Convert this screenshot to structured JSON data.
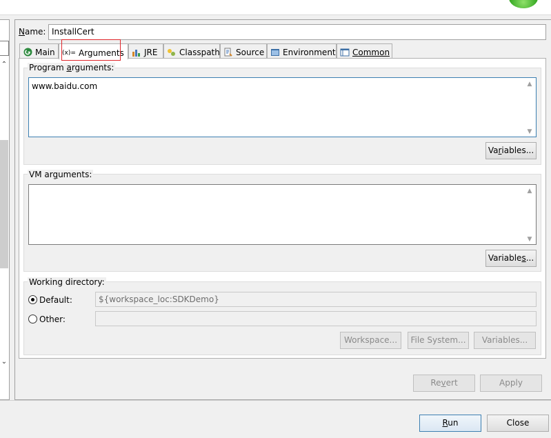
{
  "name": {
    "label_prefix": "N",
    "label_rest": "ame:",
    "value": "InstallCert"
  },
  "tabs": [
    {
      "id": "main",
      "label": "Main",
      "icon": "main-run-icon"
    },
    {
      "id": "arguments",
      "label": "Arguments",
      "icon": "arguments-icon",
      "icon_text": "(x)="
    },
    {
      "id": "jre",
      "label": "JRE",
      "icon": "jre-icon"
    },
    {
      "id": "classpath",
      "label": "Classpath",
      "icon": "classpath-icon"
    },
    {
      "id": "source",
      "label": "Source",
      "icon": "source-icon"
    },
    {
      "id": "environment",
      "label": "Environment",
      "icon": "environment-icon"
    },
    {
      "id": "common",
      "label": "Common",
      "icon": "common-icon"
    }
  ],
  "program_args": {
    "label_a": "Program ",
    "label_b": "a",
    "label_c": "rguments:",
    "value": "www.baidu.com",
    "variables_a": "Va",
    "variables_b": "r",
    "variables_c": "iables..."
  },
  "vm_args": {
    "label_a": "VM ar",
    "label_b": "g",
    "label_c": "uments:",
    "value": "",
    "variables_a": "Variable",
    "variables_b": "s",
    "variables_c": "..."
  },
  "working_dir": {
    "label": "Working directory:",
    "default_label": "Default:",
    "default_value": "${workspace_loc:SDKDemo}",
    "other_label": "Other:",
    "other_value": "",
    "workspace_btn": "Workspace...",
    "filesystem_btn": "File System...",
    "variables_btn": "Variables..."
  },
  "actions": {
    "revert_a": "Re",
    "revert_b": "v",
    "revert_c": "ert",
    "apply": "Apply"
  },
  "dialog": {
    "run_a": "R",
    "run_b": "un",
    "close": "Close"
  },
  "colors": {
    "focus_border": "#3c7fb1",
    "highlight_box": "#e0262b"
  }
}
